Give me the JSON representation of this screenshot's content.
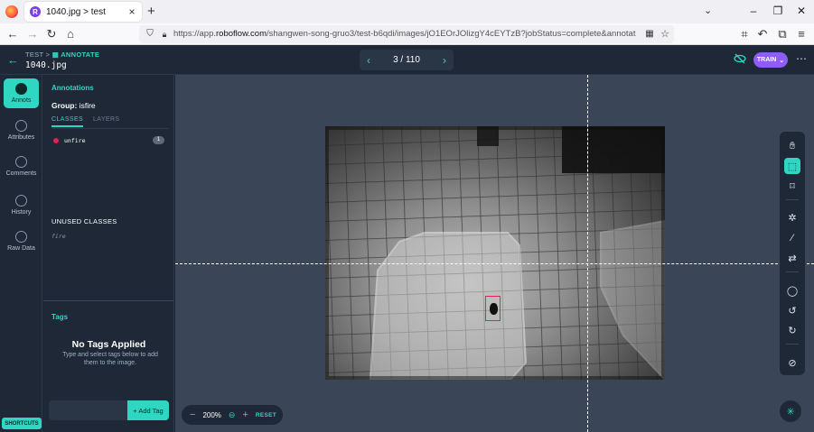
{
  "browser": {
    "tab_title": "1040.jpg > test",
    "tab_favicon": "R",
    "url_prefix": "https://app.",
    "url_domain": "roboflow.com",
    "url_rest": "/shangwen-song-gruo3/test-b6qdi/images/jO1EOrJOlizgY4cEYTzB?jobStatus=complete&annotationJob=y"
  },
  "header": {
    "crumb_project": "TEST",
    "crumb_sep": ">",
    "crumb_section": "ANNOTATE",
    "filename": "1040.jpg",
    "page_indicator": "3 / 110",
    "train_label": "TRAIN"
  },
  "rail": {
    "items": [
      {
        "label": "Annots",
        "icon": "annotations-icon"
      },
      {
        "label": "Attributes",
        "icon": "attributes-icon"
      },
      {
        "label": "Comments",
        "icon": "comments-icon"
      },
      {
        "label": "History",
        "icon": "history-icon"
      },
      {
        "label": "Raw Data",
        "icon": "raw-data-icon"
      }
    ],
    "shortcuts_label": "SHORTCUTS"
  },
  "panel": {
    "title": "Annotations",
    "group_prefix": "Group:",
    "group_value": "isfire",
    "tab_classes": "CLASSES",
    "tab_layers": "LAYERS",
    "classes": [
      {
        "name": "unfire",
        "count": "1",
        "color": "#e91e53"
      }
    ],
    "unused_heading": "UNUSED CLASSES",
    "unused": [
      "fire"
    ],
    "tags_heading": "Tags",
    "no_tags_title": "No Tags Applied",
    "no_tags_sub": "Type and select tags below to add them to the image.",
    "add_tag_label": "+ Add Tag",
    "tag_input_placeholder": ""
  },
  "canvas": {
    "zoom_value": "200%",
    "reset_label": "RESET",
    "tools": [
      "hand-icon",
      "bounding-box-icon",
      "polygon-icon",
      "smart-polygon-icon",
      "magic-wand-icon",
      "repeat-icon",
      "comment-icon",
      "undo-icon",
      "redo-icon",
      "hide-icon"
    ]
  },
  "colors": {
    "accent": "#2fd6c2",
    "train": "#8f5cf7",
    "class_unfire": "#e91e53",
    "background": "#1e2836",
    "canvas": "#3a4658"
  }
}
